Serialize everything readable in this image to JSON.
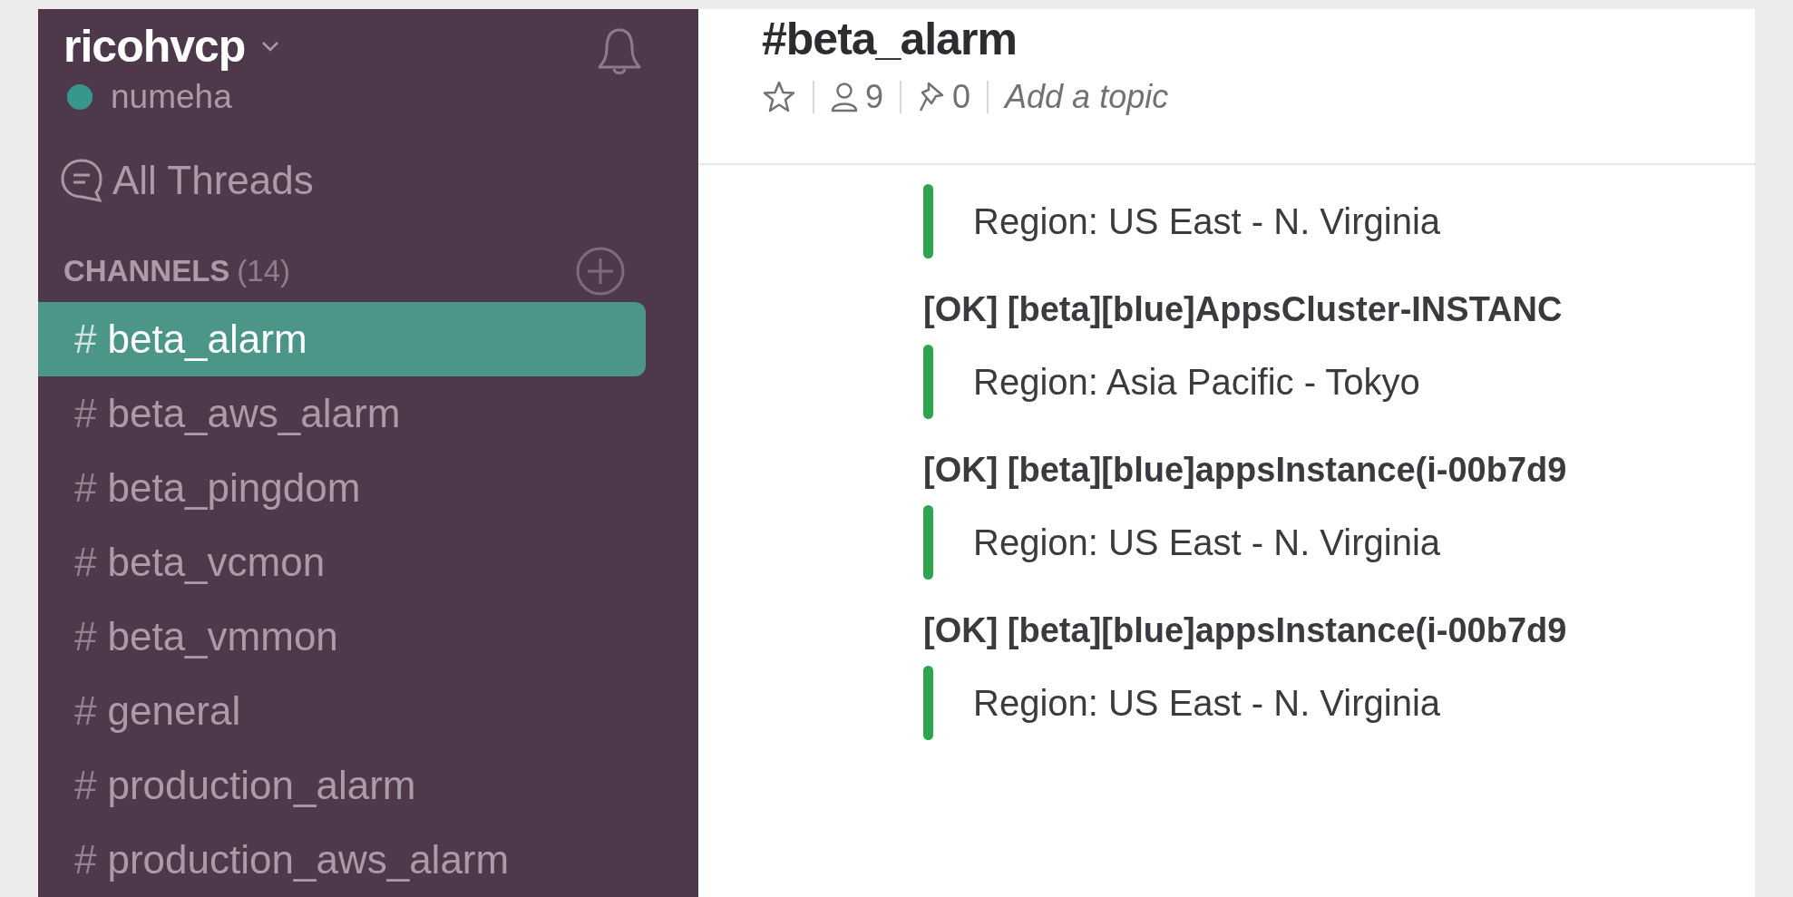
{
  "workspace": {
    "name": "ricohvcp",
    "user": "numeha",
    "online": true
  },
  "all_threads": "All Threads",
  "channels_header": {
    "label": "CHANNELS",
    "count": "(14)"
  },
  "channel_prefix": "#",
  "channels": [
    {
      "name": "beta_alarm",
      "selected": true
    },
    {
      "name": "beta_aws_alarm",
      "selected": false
    },
    {
      "name": "beta_pingdom",
      "selected": false
    },
    {
      "name": "beta_vcmon",
      "selected": false
    },
    {
      "name": "beta_vmmon",
      "selected": false
    },
    {
      "name": "general",
      "selected": false
    },
    {
      "name": "production_alarm",
      "selected": false
    },
    {
      "name": "production_aws_alarm",
      "selected": false
    }
  ],
  "channel": {
    "title": "#beta_alarm",
    "starred": false,
    "members": "9",
    "pins": "0",
    "topic_placeholder": "Add a topic"
  },
  "messages": [
    {
      "kind": "attachment",
      "text": "Region: US East - N. Virginia"
    },
    {
      "kind": "title",
      "text": "[OK] [beta][blue]AppsCluster-INSTANC"
    },
    {
      "kind": "attachment",
      "text": "Region: Asia Pacific - Tokyo"
    },
    {
      "kind": "title",
      "text": "[OK] [beta][blue]appsInstance(i-00b7d9"
    },
    {
      "kind": "attachment",
      "text": "Region: US East - N. Virginia"
    },
    {
      "kind": "title",
      "text": "[OK] [beta][blue]appsInstance(i-00b7d9"
    },
    {
      "kind": "attachment",
      "text": "Region: US East - N. Virginia"
    }
  ]
}
